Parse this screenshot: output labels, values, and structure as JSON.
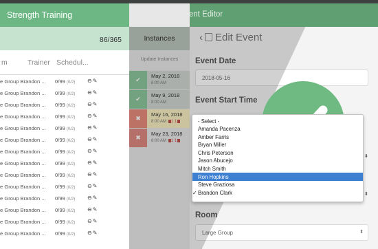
{
  "left_panel": {
    "title": "Strength Training",
    "count": "86/365",
    "columns": [
      "m",
      "Trainer",
      "Schedul..."
    ],
    "rows": [
      {
        "name": "e Group Brandon ...",
        "count": "0/99",
        "sub": "(0/2)"
      },
      {
        "name": "e Group Brandon ...",
        "count": "0/99",
        "sub": "(0/2)"
      },
      {
        "name": "e Group Brandon ...",
        "count": "0/99",
        "sub": "(0/2)"
      },
      {
        "name": "e Group Brandon ...",
        "count": "0/99",
        "sub": "(0/2)"
      },
      {
        "name": "e Group Brandon ...",
        "count": "0/99",
        "sub": "(0/2)"
      },
      {
        "name": "e Group Brandon ...",
        "count": "0/99",
        "sub": "(0/2)"
      },
      {
        "name": "e Group Brandon ...",
        "count": "0/99",
        "sub": "(0/2)"
      },
      {
        "name": "e Group Brandon ...",
        "count": "0/99",
        "sub": "(0/2)"
      },
      {
        "name": "e Group Brandon ...",
        "count": "0/99",
        "sub": "(0/2)"
      },
      {
        "name": "e Group Brandon ...",
        "count": "0/99",
        "sub": "(0/2)"
      },
      {
        "name": "e Group Brandon ...",
        "count": "0/99",
        "sub": "(0/2)"
      },
      {
        "name": "e Group Brandon ...",
        "count": "0/99",
        "sub": "(0/2)"
      },
      {
        "name": "e Group Brandon ...",
        "count": "0/99",
        "sub": "(0/2)"
      },
      {
        "name": "e Group Brandon ...",
        "count": "0/99",
        "sub": "(0/2)"
      }
    ]
  },
  "topbar": {
    "back": "‹",
    "title": "Multi Event Editor"
  },
  "instances": {
    "title": "Instances",
    "update": "Update Instances",
    "items": [
      {
        "date": "May 2, 2018",
        "time": "8:00 AM",
        "status": "done",
        "color": "#8bc59b"
      },
      {
        "date": "May 9, 2018",
        "time": "8:00 AM",
        "status": "done",
        "color": "#8bc59b"
      },
      {
        "date": "May 16, 2018",
        "time": "8:00 AM",
        "status": "cancel",
        "color": "#e58c7d",
        "counts": "1 1"
      },
      {
        "date": "May 23, 2018",
        "time": "8:00 AM",
        "status": "cancel",
        "color": "#dd8a80",
        "counts": "1 1"
      }
    ]
  },
  "editor": {
    "heading": "Edit Event",
    "event_date_label": "Event Date",
    "event_date_value": "2018-05-16",
    "start_time_label": "Event Start Time",
    "room_label": "Room",
    "room_value": "Large Group"
  },
  "dropdown": {
    "options": [
      "- Select -",
      "Amanda Pacenza",
      "Amber Farris",
      "Bryan Miller",
      "Chris Peterson",
      "Jason Abucejo",
      "Mitch Smith",
      "Ron Hopkins",
      "Steve Graziosa",
      "Brandon Clark"
    ],
    "highlighted": "Ron Hopkins",
    "selected": "Brandon Clark"
  },
  "colors": {
    "green_bar": "#6db784",
    "highlight": "#3d7fd0",
    "badge": "#6fba82"
  }
}
